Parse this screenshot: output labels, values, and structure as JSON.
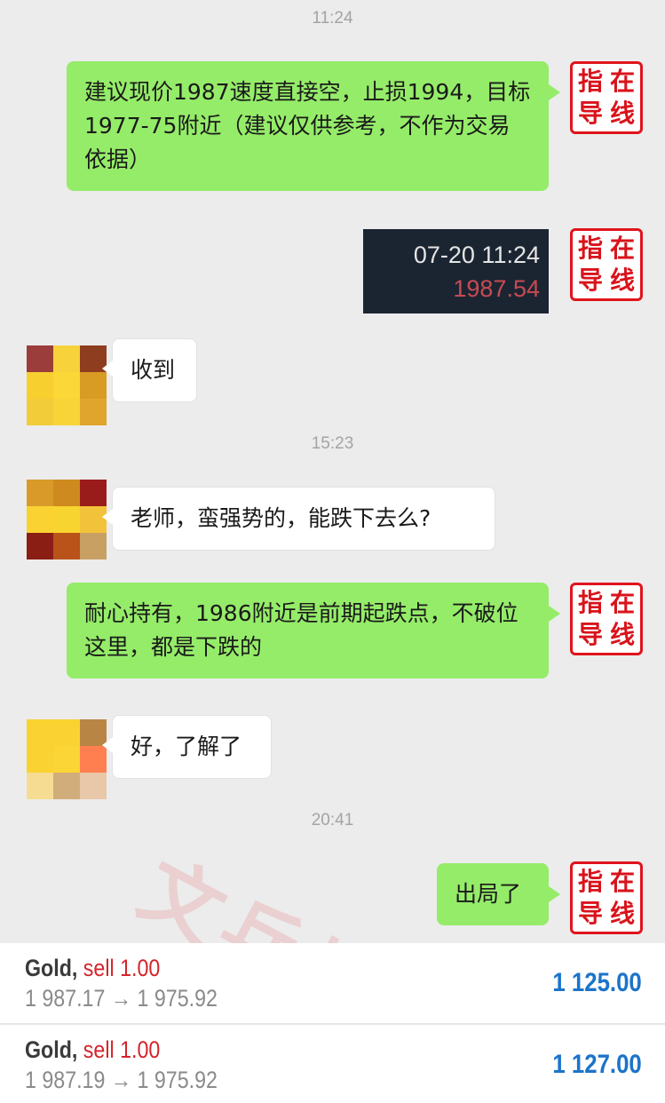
{
  "timestamps": [
    "11:24",
    "15:23",
    "20:41"
  ],
  "seal_chars": [
    "指",
    "在",
    "导",
    "线"
  ],
  "messages": {
    "m1": "建议现价1987速度直接空，止损1994，目标1977-75附近（建议仅供参考，不作为交易依据）",
    "snapshot": {
      "time": "07-20 11:24",
      "price": "1987.54"
    },
    "m2": "收到",
    "m3": "老师，蛮强势的，能跌下去么?",
    "m4": "耐心持有，1986附近是前期起跌点，不破位这里，都是下跌的",
    "m5": "好，了解了",
    "m6": "出局了"
  },
  "watermark": "文兵指导",
  "trades": [
    {
      "symbol": "Gold,",
      "side": "sell 1.00",
      "prices": "1 987.17 → 1 975.92",
      "profit": "1 125.00"
    },
    {
      "symbol": "Gold,",
      "side": "sell 1.00",
      "prices": "1 987.19 → 1 975.92",
      "profit": "1 127.00"
    }
  ],
  "colors": {
    "outgoing_bubble": "#95ec69",
    "incoming_bubble": "#ffffff",
    "seal_red": "#e0141c",
    "sell_red": "#d3242b",
    "profit_blue": "#1c74c9"
  },
  "avatars": {
    "a1": [
      "#9b3d3a",
      "#f7d23a",
      "#8f3d1f",
      "#f7cf2f",
      "#fbd737",
      "#d89b24",
      "#f3cc3a",
      "#f8d438",
      "#e0a52d"
    ],
    "a2": [
      "#d99a2a",
      "#cf8a1f",
      "#9a1c1a",
      "#fad232",
      "#f7d42f",
      "#f2c33a",
      "#8a1d14",
      "#b9531a",
      "#c9a063"
    ],
    "a3": [
      "#fad232",
      "#fad232",
      "#b98545",
      "#fad232",
      "#fbd535",
      "#ff7f50",
      "#f5dc92",
      "#d2ad7c",
      "#e8c8a8"
    ]
  }
}
